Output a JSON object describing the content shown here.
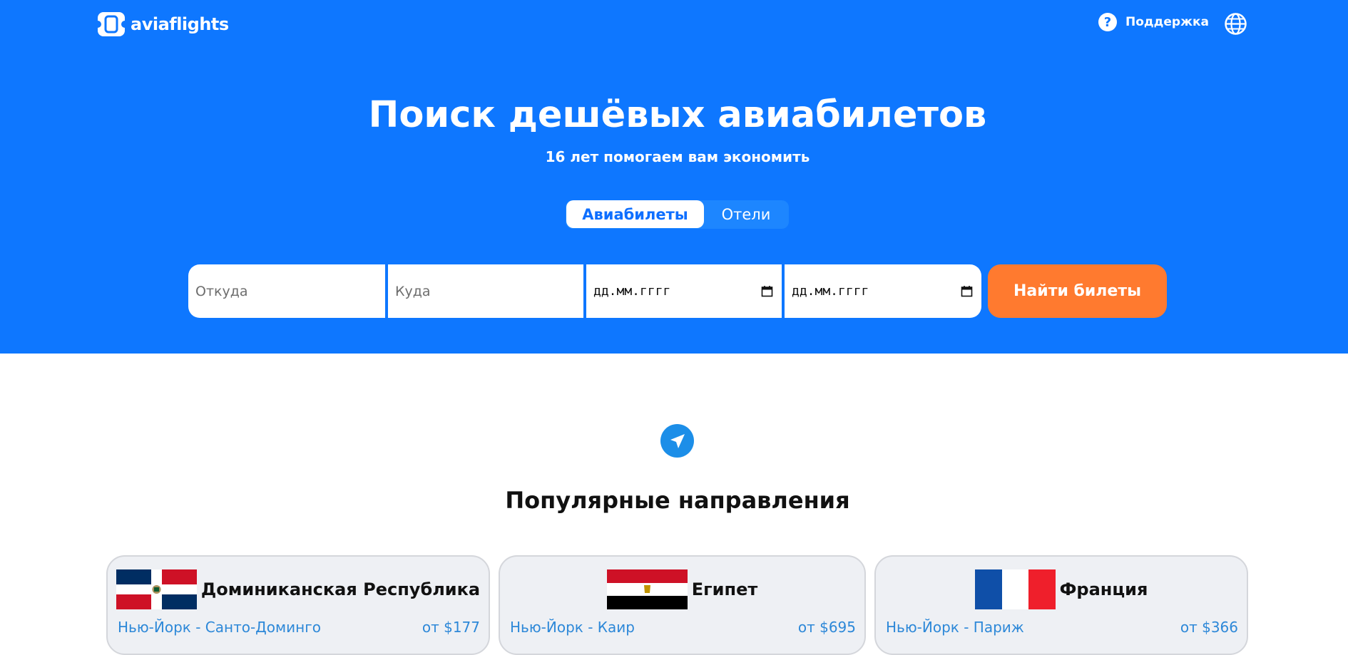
{
  "header": {
    "logo_text": "aviaflights",
    "support_label": "Поддержка",
    "support_icon": "question-circle-icon",
    "language_icon": "globe-icon"
  },
  "hero": {
    "title": "Поиск дешёвых авиабилетов",
    "subtitle": "16 лет помогаем вам экономить",
    "tabs": [
      {
        "label": "Авиабилеты",
        "active": true
      },
      {
        "label": "Отели",
        "active": false
      }
    ],
    "accent_color": "#0e77ff"
  },
  "search": {
    "from_placeholder": "Откуда",
    "to_placeholder": "Куда",
    "depart_date": "дд.мм.гггг",
    "return_date": "дд.мм.гггг",
    "submit_label": "Найти билеты",
    "submit_color": "#ff7a2f"
  },
  "popular": {
    "icon": "paper-plane-icon",
    "title": "Популярные направления",
    "destinations": [
      {
        "country": "Доминиканская Республика",
        "route": "Нью-Йорк - Санто-Доминго",
        "price": "от $177",
        "flag": "dominican-republic-flag"
      },
      {
        "country": "Египет",
        "route": "Нью-Йорк - Каир",
        "price": "от $695",
        "flag": "egypt-flag"
      },
      {
        "country": "Франция",
        "route": "Нью-Йорк - Париж",
        "price": "от $366",
        "flag": "france-flag"
      }
    ]
  }
}
